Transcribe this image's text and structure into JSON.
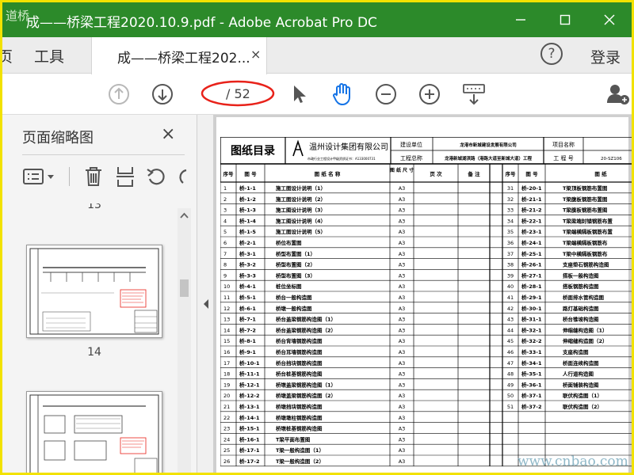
{
  "window": {
    "title": "成——桥梁工程2020.10.9.pdf - Adobe Acrobat Pro DC",
    "watermark_top": "道桥"
  },
  "menu": {
    "home_partial": "页",
    "tools": "工具",
    "login": "登录",
    "help_symbol": "?"
  },
  "tab": {
    "label": "成——桥梁工程202...",
    "close": "×"
  },
  "toolbar": {
    "page_input": "",
    "page_total": "/ 52"
  },
  "sidebar": {
    "title": "页面缩略图",
    "close": "×",
    "thumb_prev_num": "13",
    "thumb_num_14": "14"
  },
  "doc": {
    "header": {
      "catalog_title": "图纸目录",
      "company": "温州设计集团有限公司",
      "company_sub": "市政行业工程设计甲级资质证书：A133000731",
      "builder_label": "建设单位",
      "builder_value": "龙港市新城建设发展有限公司",
      "project_label": "工程总称",
      "project_value": "龙港新城湖滨路（港路大道至新城大道）工程",
      "item_name_label": "项目名称",
      "item_no_label": "工 程 号",
      "item_no_value": "20-SZ106"
    },
    "columns": {
      "seq": "序号",
      "no": "图 号",
      "name": "图 纸 名 称",
      "size": "图 纸 尺 寸",
      "pages": "页 次",
      "remark": "备 注"
    },
    "rows": [
      [
        "1",
        "桥-1-1",
        "施工图设计说明（1）",
        "A3"
      ],
      [
        "2",
        "桥-1-2",
        "施工图设计说明（2）",
        "A3"
      ],
      [
        "3",
        "桥-1-3",
        "施工图设计说明（3）",
        "A3"
      ],
      [
        "4",
        "桥-1-4",
        "施工图设计说明（4）",
        "A3"
      ],
      [
        "5",
        "桥-1-5",
        "施工图设计说明（5）",
        "A3"
      ],
      [
        "6",
        "桥-2-1",
        "桥位布置图",
        "A3"
      ],
      [
        "7",
        "桥-3-1",
        "桥型布置图（1）",
        "A3"
      ],
      [
        "8",
        "桥-3-2",
        "桥型布置图（2）",
        "A3"
      ],
      [
        "9",
        "桥-3-3",
        "桥型布置图（3）",
        "A3"
      ],
      [
        "10",
        "桥-4-1",
        "桩位坐标图",
        "A3"
      ],
      [
        "11",
        "桥-5-1",
        "桥台一般构造图",
        "A3"
      ],
      [
        "12",
        "桥-6-1",
        "桥墩一般构造图",
        "A3"
      ],
      [
        "13",
        "桥-7-1",
        "桥台盖梁钢筋构造图（1）",
        "A3"
      ],
      [
        "14",
        "桥-7-2",
        "桥台盖梁钢筋构造图（2）",
        "A3"
      ],
      [
        "15",
        "桥-8-1",
        "桥台背墙钢筋构造图",
        "A3"
      ],
      [
        "16",
        "桥-9-1",
        "桥台耳墙钢筋构造图",
        "A3"
      ],
      [
        "17",
        "桥-10-1",
        "桥台挡块钢筋构造图",
        "A3"
      ],
      [
        "18",
        "桥-11-1",
        "桥台桩基钢筋构造图",
        "A3"
      ],
      [
        "19",
        "桥-12-1",
        "桥墩盖梁钢筋构造图（1）",
        "A3"
      ],
      [
        "20",
        "桥-12-2",
        "桥墩盖梁钢筋构造图（2）",
        "A3"
      ],
      [
        "21",
        "桥-13-1",
        "桥墩挡块钢筋构造图",
        "A3"
      ],
      [
        "22",
        "桥-14-1",
        "桥墩墩柱钢筋构造图",
        "A3"
      ],
      [
        "23",
        "桥-15-1",
        "桥墩桩基钢筋构造图",
        "A3"
      ],
      [
        "24",
        "桥-16-1",
        "T梁平面布置图",
        "A3"
      ],
      [
        "25",
        "桥-17-1",
        "T梁一般构造图（1）",
        "A3"
      ],
      [
        "26",
        "桥-17-2",
        "T梁一般构造图（2）",
        "A3"
      ]
    ],
    "rows_right": [
      [
        "31",
        "桥-20-1",
        "T梁顶板钢筋布置图"
      ],
      [
        "32",
        "桥-21-1",
        "T梁腹板钢筋布置图"
      ],
      [
        "33",
        "桥-21-2",
        "T梁腹板钢筋布置图"
      ],
      [
        "34",
        "桥-22-1",
        "T梁梁端封锚钢筋布置"
      ],
      [
        "35",
        "桥-23-1",
        "T梁端横隔板钢筋布置"
      ],
      [
        "36",
        "桥-24-1",
        "T梁端横隔板钢筋布"
      ],
      [
        "37",
        "桥-25-1",
        "T梁中横隔板钢筋布"
      ],
      [
        "38",
        "桥-26-1",
        "支座垫石钢筋构造图"
      ],
      [
        "39",
        "桥-27-1",
        "搭板一般构造图"
      ],
      [
        "40",
        "桥-28-1",
        "搭板钢筋构造图"
      ],
      [
        "41",
        "桥-29-1",
        "桥面排水管构造图"
      ],
      [
        "42",
        "桥-30-1",
        "路灯基础构造图"
      ],
      [
        "43",
        "桥-31-1",
        "桥台锥坡构造图"
      ],
      [
        "44",
        "桥-32-1",
        "伸缩缝构造图（1）"
      ],
      [
        "45",
        "桥-32-2",
        "伸缩缝构造图（2）"
      ],
      [
        "46",
        "桥-33-1",
        "支座构造图"
      ],
      [
        "47",
        "桥-34-1",
        "桥面连续构造图"
      ],
      [
        "48",
        "桥-35-1",
        "人行道构造图"
      ],
      [
        "49",
        "桥-36-1",
        "桥面铺装构造图"
      ],
      [
        "50",
        "桥-37-1",
        "联伏构造图（1）"
      ],
      [
        "51",
        "桥-37-2",
        "联伏构造图（2）"
      ]
    ],
    "right_header_partial": "图 纸"
  },
  "watermark_bottom": "www.cnbao.com",
  "colors": {
    "titlebar": "#2c8a2a",
    "annotation": "#e8221a",
    "accent_blue": "#1473e6",
    "frame": "#f2e200"
  }
}
